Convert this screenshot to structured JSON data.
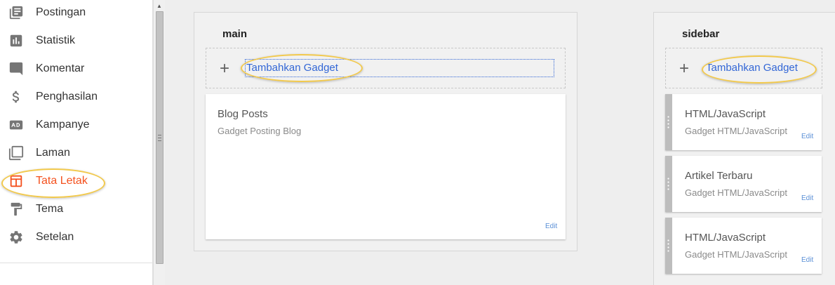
{
  "nav": {
    "items": [
      {
        "label": "Postingan",
        "icon": "posts-icon"
      },
      {
        "label": "Statistik",
        "icon": "stats-icon"
      },
      {
        "label": "Komentar",
        "icon": "comment-icon"
      },
      {
        "label": "Penghasilan",
        "icon": "dollar-icon"
      },
      {
        "label": "Kampanye",
        "icon": "ad-icon"
      },
      {
        "label": "Laman",
        "icon": "pages-icon"
      },
      {
        "label": "Tata Letak",
        "icon": "layout-icon",
        "active": true
      },
      {
        "label": "Tema",
        "icon": "paint-roller-icon"
      },
      {
        "label": "Setelan",
        "icon": "gear-icon"
      }
    ],
    "active_color": "#f4511e"
  },
  "main_section": {
    "title": "main",
    "add_gadget_label": "Tambahkan Gadget",
    "gadgets": [
      {
        "title": "Blog Posts",
        "subtitle": "Gadget Posting Blog",
        "edit": "Edit"
      }
    ]
  },
  "sidebar_section": {
    "title": "sidebar",
    "add_gadget_label": "Tambahkan Gadget",
    "gadgets": [
      {
        "title": "HTML/JavaScript",
        "subtitle": "Gadget HTML/JavaScript",
        "edit": "Edit"
      },
      {
        "title": "Artikel Terbaru",
        "subtitle": "Gadget HTML/JavaScript",
        "edit": "Edit"
      },
      {
        "title": "HTML/JavaScript",
        "subtitle": "Gadget HTML/JavaScript",
        "edit": "Edit"
      }
    ]
  },
  "colors": {
    "link": "#3367d6",
    "highlight": "#f2c94c"
  }
}
